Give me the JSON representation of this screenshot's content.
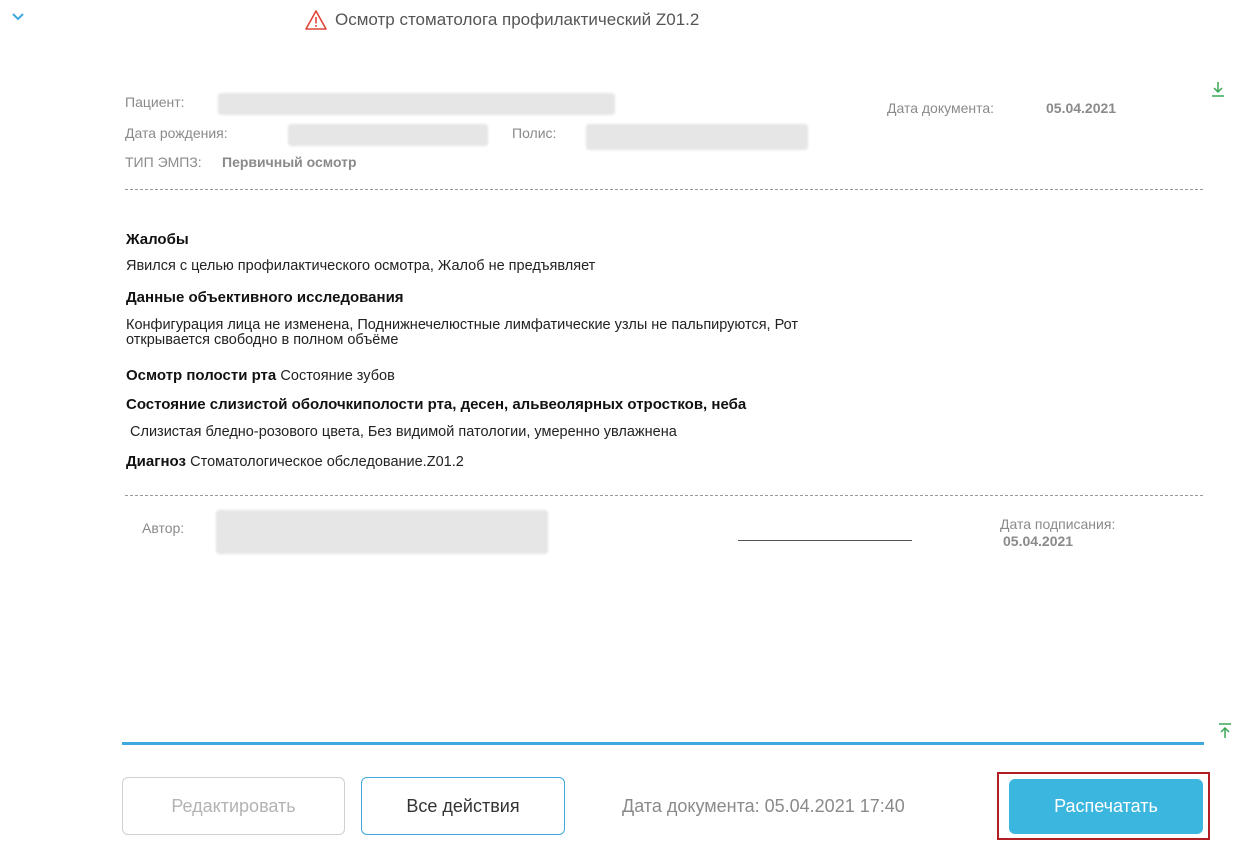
{
  "header": {
    "title": "Осмотр стоматолога профилактический Z01.2"
  },
  "document": {
    "patient_label": "Пациент:",
    "doc_date_label": "Дата документа:",
    "doc_date_value": "05.04.2021",
    "birth_label": "Дата рождения:",
    "policy_label": "Полис:",
    "emz_type_label": "ТИП ЭМПЗ:",
    "emz_type_value": "Первичный осмотр",
    "sections": {
      "complaints_title": "Жалобы",
      "complaints_text": "Явился с целью профилактического осмотра, Жалоб не предъявляет",
      "objective_title": "Данные объективного исследования",
      "objective_text_1": "Конфигурация лица не изменена, Поднижнечелюстные лимфатические узлы не пальпируются, Рот",
      "objective_text_2": "открывается свободно в полном объёме",
      "oral_title": "Осмотр полости рта",
      "oral_text": "Состояние зубов",
      "mucosa_title": "Состояние слизистой оболочкиполости рта, десен, альвеолярных отростков, неба",
      "mucosa_text": " Слизистая бледно-розового цвета, Без видимой патологии, умеренно увлажнена",
      "diagnosis_title": "Диагноз",
      "diagnosis_text": "Стоматологическое обследование.Z01.2"
    },
    "author_label": "Автор:",
    "sign_date_label": "Дата подписания:",
    "sign_date_value": "05.04.2021"
  },
  "footer": {
    "edit_label": "Редактировать",
    "actions_label": "Все действия",
    "doc_date_text": "Дата документа: 05.04.2021 17:40",
    "print_label": "Распечатать"
  },
  "colors": {
    "accent": "#3fa8dc",
    "print_button": "#3bb6de",
    "highlight": "#b01f24",
    "warning": "#e0453a"
  },
  "icons": {
    "collapse": "chevron-down-icon",
    "warning": "warning-triangle-icon",
    "scroll_down": "arrow-down-to-line-icon",
    "scroll_up": "arrow-up-to-line-icon"
  }
}
